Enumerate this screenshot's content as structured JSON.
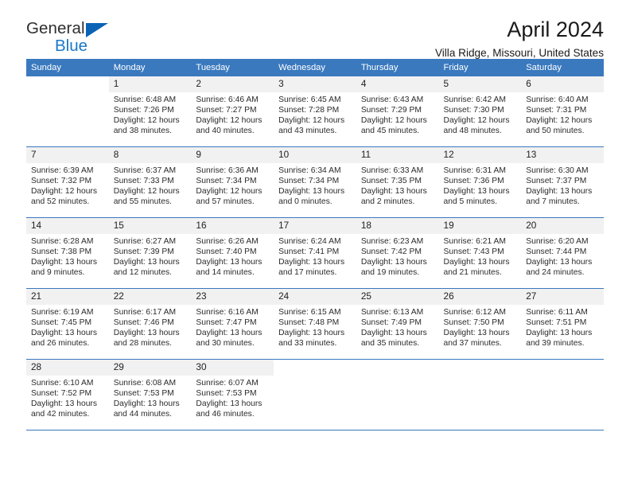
{
  "brand": {
    "name_part1": "General",
    "name_part2": "Blue",
    "triangle_color": "#0a63b5",
    "blue_color": "#1878c8"
  },
  "header": {
    "title": "April 2024",
    "subtitle": "Villa Ridge, Missouri, United States",
    "header_bg": "#3a79be",
    "header_text_color": "#ffffff",
    "daynum_bg": "#f1f1f1",
    "separator_color": "#3a79be"
  },
  "weekdays": [
    "Sunday",
    "Monday",
    "Tuesday",
    "Wednesday",
    "Thursday",
    "Friday",
    "Saturday"
  ],
  "weeks": [
    [
      {
        "day": "",
        "blank": true,
        "sunrise": "",
        "sunset": "",
        "daylight1": "",
        "daylight2": ""
      },
      {
        "day": "1",
        "sunrise": "Sunrise: 6:48 AM",
        "sunset": "Sunset: 7:26 PM",
        "daylight1": "Daylight: 12 hours",
        "daylight2": "and 38 minutes."
      },
      {
        "day": "2",
        "sunrise": "Sunrise: 6:46 AM",
        "sunset": "Sunset: 7:27 PM",
        "daylight1": "Daylight: 12 hours",
        "daylight2": "and 40 minutes."
      },
      {
        "day": "3",
        "sunrise": "Sunrise: 6:45 AM",
        "sunset": "Sunset: 7:28 PM",
        "daylight1": "Daylight: 12 hours",
        "daylight2": "and 43 minutes."
      },
      {
        "day": "4",
        "sunrise": "Sunrise: 6:43 AM",
        "sunset": "Sunset: 7:29 PM",
        "daylight1": "Daylight: 12 hours",
        "daylight2": "and 45 minutes."
      },
      {
        "day": "5",
        "sunrise": "Sunrise: 6:42 AM",
        "sunset": "Sunset: 7:30 PM",
        "daylight1": "Daylight: 12 hours",
        "daylight2": "and 48 minutes."
      },
      {
        "day": "6",
        "sunrise": "Sunrise: 6:40 AM",
        "sunset": "Sunset: 7:31 PM",
        "daylight1": "Daylight: 12 hours",
        "daylight2": "and 50 minutes."
      }
    ],
    [
      {
        "day": "7",
        "sunrise": "Sunrise: 6:39 AM",
        "sunset": "Sunset: 7:32 PM",
        "daylight1": "Daylight: 12 hours",
        "daylight2": "and 52 minutes."
      },
      {
        "day": "8",
        "sunrise": "Sunrise: 6:37 AM",
        "sunset": "Sunset: 7:33 PM",
        "daylight1": "Daylight: 12 hours",
        "daylight2": "and 55 minutes."
      },
      {
        "day": "9",
        "sunrise": "Sunrise: 6:36 AM",
        "sunset": "Sunset: 7:34 PM",
        "daylight1": "Daylight: 12 hours",
        "daylight2": "and 57 minutes."
      },
      {
        "day": "10",
        "sunrise": "Sunrise: 6:34 AM",
        "sunset": "Sunset: 7:34 PM",
        "daylight1": "Daylight: 13 hours",
        "daylight2": "and 0 minutes."
      },
      {
        "day": "11",
        "sunrise": "Sunrise: 6:33 AM",
        "sunset": "Sunset: 7:35 PM",
        "daylight1": "Daylight: 13 hours",
        "daylight2": "and 2 minutes."
      },
      {
        "day": "12",
        "sunrise": "Sunrise: 6:31 AM",
        "sunset": "Sunset: 7:36 PM",
        "daylight1": "Daylight: 13 hours",
        "daylight2": "and 5 minutes."
      },
      {
        "day": "13",
        "sunrise": "Sunrise: 6:30 AM",
        "sunset": "Sunset: 7:37 PM",
        "daylight1": "Daylight: 13 hours",
        "daylight2": "and 7 minutes."
      }
    ],
    [
      {
        "day": "14",
        "sunrise": "Sunrise: 6:28 AM",
        "sunset": "Sunset: 7:38 PM",
        "daylight1": "Daylight: 13 hours",
        "daylight2": "and 9 minutes."
      },
      {
        "day": "15",
        "sunrise": "Sunrise: 6:27 AM",
        "sunset": "Sunset: 7:39 PM",
        "daylight1": "Daylight: 13 hours",
        "daylight2": "and 12 minutes."
      },
      {
        "day": "16",
        "sunrise": "Sunrise: 6:26 AM",
        "sunset": "Sunset: 7:40 PM",
        "daylight1": "Daylight: 13 hours",
        "daylight2": "and 14 minutes."
      },
      {
        "day": "17",
        "sunrise": "Sunrise: 6:24 AM",
        "sunset": "Sunset: 7:41 PM",
        "daylight1": "Daylight: 13 hours",
        "daylight2": "and 17 minutes."
      },
      {
        "day": "18",
        "sunrise": "Sunrise: 6:23 AM",
        "sunset": "Sunset: 7:42 PM",
        "daylight1": "Daylight: 13 hours",
        "daylight2": "and 19 minutes."
      },
      {
        "day": "19",
        "sunrise": "Sunrise: 6:21 AM",
        "sunset": "Sunset: 7:43 PM",
        "daylight1": "Daylight: 13 hours",
        "daylight2": "and 21 minutes."
      },
      {
        "day": "20",
        "sunrise": "Sunrise: 6:20 AM",
        "sunset": "Sunset: 7:44 PM",
        "daylight1": "Daylight: 13 hours",
        "daylight2": "and 24 minutes."
      }
    ],
    [
      {
        "day": "21",
        "sunrise": "Sunrise: 6:19 AM",
        "sunset": "Sunset: 7:45 PM",
        "daylight1": "Daylight: 13 hours",
        "daylight2": "and 26 minutes."
      },
      {
        "day": "22",
        "sunrise": "Sunrise: 6:17 AM",
        "sunset": "Sunset: 7:46 PM",
        "daylight1": "Daylight: 13 hours",
        "daylight2": "and 28 minutes."
      },
      {
        "day": "23",
        "sunrise": "Sunrise: 6:16 AM",
        "sunset": "Sunset: 7:47 PM",
        "daylight1": "Daylight: 13 hours",
        "daylight2": "and 30 minutes."
      },
      {
        "day": "24",
        "sunrise": "Sunrise: 6:15 AM",
        "sunset": "Sunset: 7:48 PM",
        "daylight1": "Daylight: 13 hours",
        "daylight2": "and 33 minutes."
      },
      {
        "day": "25",
        "sunrise": "Sunrise: 6:13 AM",
        "sunset": "Sunset: 7:49 PM",
        "daylight1": "Daylight: 13 hours",
        "daylight2": "and 35 minutes."
      },
      {
        "day": "26",
        "sunrise": "Sunrise: 6:12 AM",
        "sunset": "Sunset: 7:50 PM",
        "daylight1": "Daylight: 13 hours",
        "daylight2": "and 37 minutes."
      },
      {
        "day": "27",
        "sunrise": "Sunrise: 6:11 AM",
        "sunset": "Sunset: 7:51 PM",
        "daylight1": "Daylight: 13 hours",
        "daylight2": "and 39 minutes."
      }
    ],
    [
      {
        "day": "28",
        "sunrise": "Sunrise: 6:10 AM",
        "sunset": "Sunset: 7:52 PM",
        "daylight1": "Daylight: 13 hours",
        "daylight2": "and 42 minutes."
      },
      {
        "day": "29",
        "sunrise": "Sunrise: 6:08 AM",
        "sunset": "Sunset: 7:53 PM",
        "daylight1": "Daylight: 13 hours",
        "daylight2": "and 44 minutes."
      },
      {
        "day": "30",
        "sunrise": "Sunrise: 6:07 AM",
        "sunset": "Sunset: 7:53 PM",
        "daylight1": "Daylight: 13 hours",
        "daylight2": "and 46 minutes."
      },
      {
        "day": "",
        "blank": true,
        "sunrise": "",
        "sunset": "",
        "daylight1": "",
        "daylight2": ""
      },
      {
        "day": "",
        "blank": true,
        "sunrise": "",
        "sunset": "",
        "daylight1": "",
        "daylight2": ""
      },
      {
        "day": "",
        "blank": true,
        "sunrise": "",
        "sunset": "",
        "daylight1": "",
        "daylight2": ""
      },
      {
        "day": "",
        "blank": true,
        "sunrise": "",
        "sunset": "",
        "daylight1": "",
        "daylight2": ""
      }
    ]
  ]
}
